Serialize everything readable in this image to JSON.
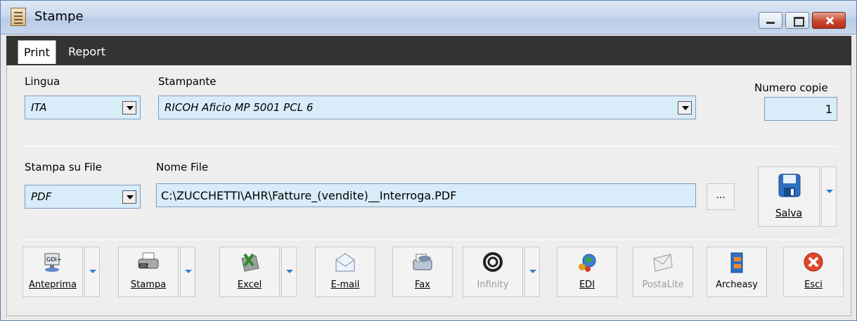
{
  "window": {
    "title": "Stampe"
  },
  "tabs": [
    {
      "label": "Print",
      "active": true
    },
    {
      "label": "Report",
      "active": false
    }
  ],
  "print": {
    "lingua_label": "Lingua",
    "lingua_value": "ITA",
    "stampante_label": "Stampante",
    "stampante_value": "RICOH Aficio MP 5001 PCL 6",
    "copie_label": "Numero copie",
    "copie_value": "1",
    "stampa_file_label": "Stampa su File",
    "stampa_file_value": "PDF",
    "nome_file_label": "Nome File",
    "nome_file_value": "C:\\ZUCCHETTI\\AHR\\Fatture_(vendite)__Interroga.PDF",
    "browse_label": "...",
    "salva_label": "Salva"
  },
  "toolbar": [
    {
      "label": "Anteprima",
      "icon": "preview-icon",
      "enabled": true
    },
    {
      "label": "Stampa",
      "icon": "printer-icon",
      "enabled": true
    },
    {
      "label": "Excel",
      "icon": "excel-icon",
      "enabled": true
    },
    {
      "label": "E-mail",
      "icon": "email-icon",
      "enabled": true
    },
    {
      "label": "Fax",
      "icon": "fax-icon",
      "enabled": true
    },
    {
      "label": "Infinity",
      "icon": "infinity-icon",
      "enabled": false
    },
    {
      "label": "EDI",
      "icon": "edi-globe-icon",
      "enabled": true
    },
    {
      "label": "PostaLite",
      "icon": "postalite-icon",
      "enabled": false
    },
    {
      "label": "Archeasy",
      "icon": "archeasy-icon",
      "enabled": true
    },
    {
      "label": "Esci",
      "icon": "exit-icon",
      "enabled": true
    }
  ],
  "colors": {
    "field_bg": "#d8ecf9",
    "tabbar_bg": "#333333",
    "close_red": "#c9452d"
  }
}
